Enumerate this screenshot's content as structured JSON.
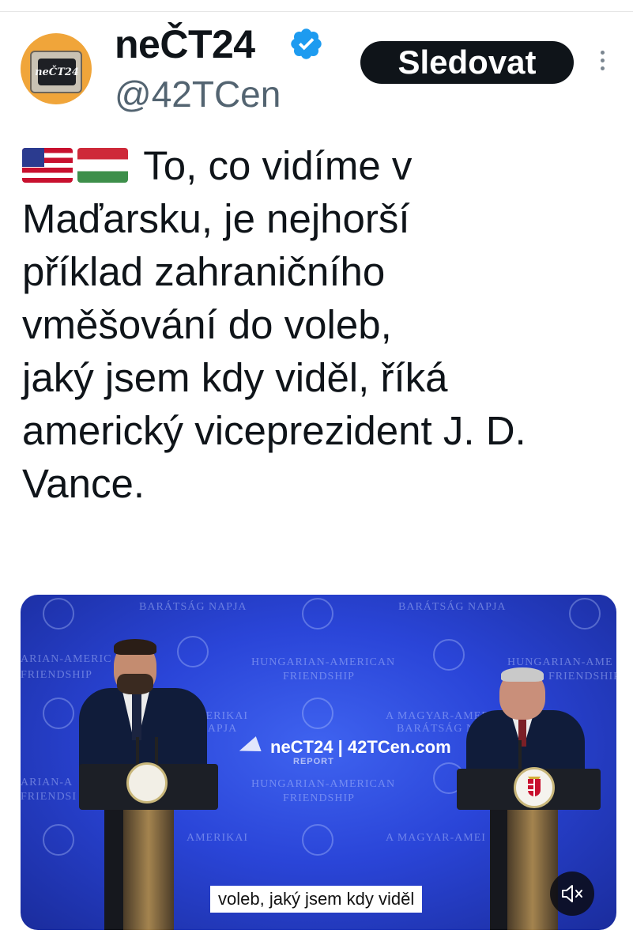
{
  "author": {
    "display_name": "neČT24",
    "handle": "@42TCen",
    "avatar_text": "neČT24",
    "verified": true
  },
  "actions": {
    "follow_label": "Sledovat"
  },
  "tweet": {
    "flags": [
      "us-flag",
      "hungary-flag"
    ],
    "lines": [
      "To, co vidíme v",
      "Maďarsku, je nejhorší",
      "příklad zahraničního",
      "vměšování do voleb,",
      "jaký jsem kdy viděl, říká",
      "americký viceprezident J. D.",
      "Vance."
    ]
  },
  "media": {
    "watermark": "neCT24 | 42TCen.com",
    "watermark_sub": "REPORT",
    "subtitle": "voleb, jaký jsem kdy viděl",
    "backdrop_text": [
      "BARÁTSÁG NAPJA",
      "BARÁTSÁG NAPJA",
      "HUNGARIAN-AMERICAN",
      "FRIENDSHIP",
      "ARIAN-AMERIC",
      "FRIENDSHIP",
      "HUNGARIAN-AME",
      "FRIENDSHIP",
      "AMERIKAI",
      "G NAPJA",
      "A MAGYAR-AMERI",
      "BARÁTSÁG NA",
      "HUNGARIAN-AMERICAN",
      "FRIENDSHIP",
      "ARIAN-A",
      "FRIENDSI",
      "AMERIKAI",
      "A MAGYAR-AMEI"
    ]
  },
  "colors": {
    "follow_bg": "#0f1419",
    "verified": "#1d9bf0",
    "handle": "#536471",
    "stage_blue": "#2a45d8"
  }
}
